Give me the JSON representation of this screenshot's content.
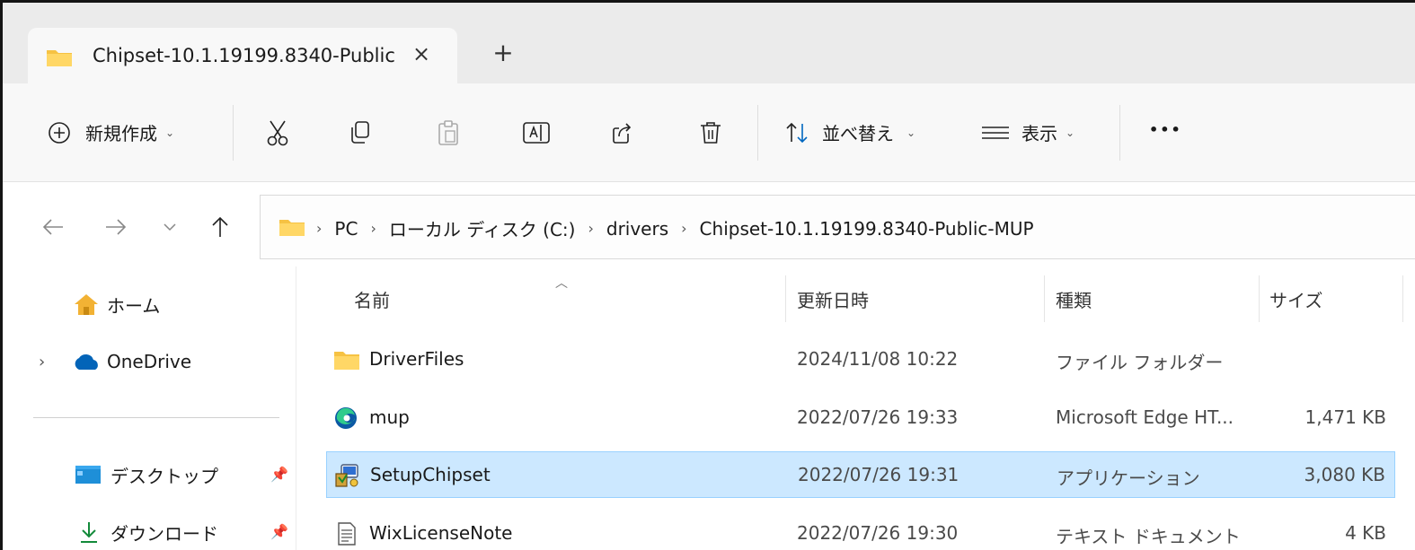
{
  "tab": {
    "title": "Chipset-10.1.19199.8340-Public",
    "close_glyph": "×",
    "new_glyph": "+"
  },
  "toolbar": {
    "new_label": "新規作成",
    "sort_label": "並べ替え",
    "view_label": "表示",
    "more_glyph": "•••",
    "chevron": "⌄"
  },
  "breadcrumb": {
    "items": [
      "PC",
      "ローカル ディスク (C:)",
      "drivers",
      "Chipset-10.1.19199.8340-Public-MUP"
    ],
    "separator": "›"
  },
  "sidebar": {
    "home": "ホーム",
    "onedrive": "OneDrive",
    "desktop": "デスクトップ",
    "downloads": "ダウンロード",
    "expand_glyph": "›"
  },
  "columns": {
    "name": "名前",
    "date": "更新日時",
    "type": "種類",
    "size": "サイズ"
  },
  "files": [
    {
      "name": "DriverFiles",
      "date": "2024/11/08 10:22",
      "type": "ファイル フォルダー",
      "size": "",
      "icon": "folder-icon"
    },
    {
      "name": "mup",
      "date": "2022/07/26 19:33",
      "type": "Microsoft Edge HT...",
      "size": "1,471 KB",
      "icon": "edge-icon"
    },
    {
      "name": "SetupChipset",
      "date": "2022/07/26 19:31",
      "type": "アプリケーション",
      "size": "3,080 KB",
      "icon": "installer-icon",
      "selected": true
    },
    {
      "name": "WixLicenseNote",
      "date": "2022/07/26 19:30",
      "type": "テキスト ドキュメント",
      "size": "4 KB",
      "icon": "text-file-icon"
    }
  ],
  "colors": {
    "selection_bg": "#cce8ff",
    "selection_border": "#99d1ff",
    "folder_yellow": "#f6c243",
    "accent": "#0067c0"
  }
}
